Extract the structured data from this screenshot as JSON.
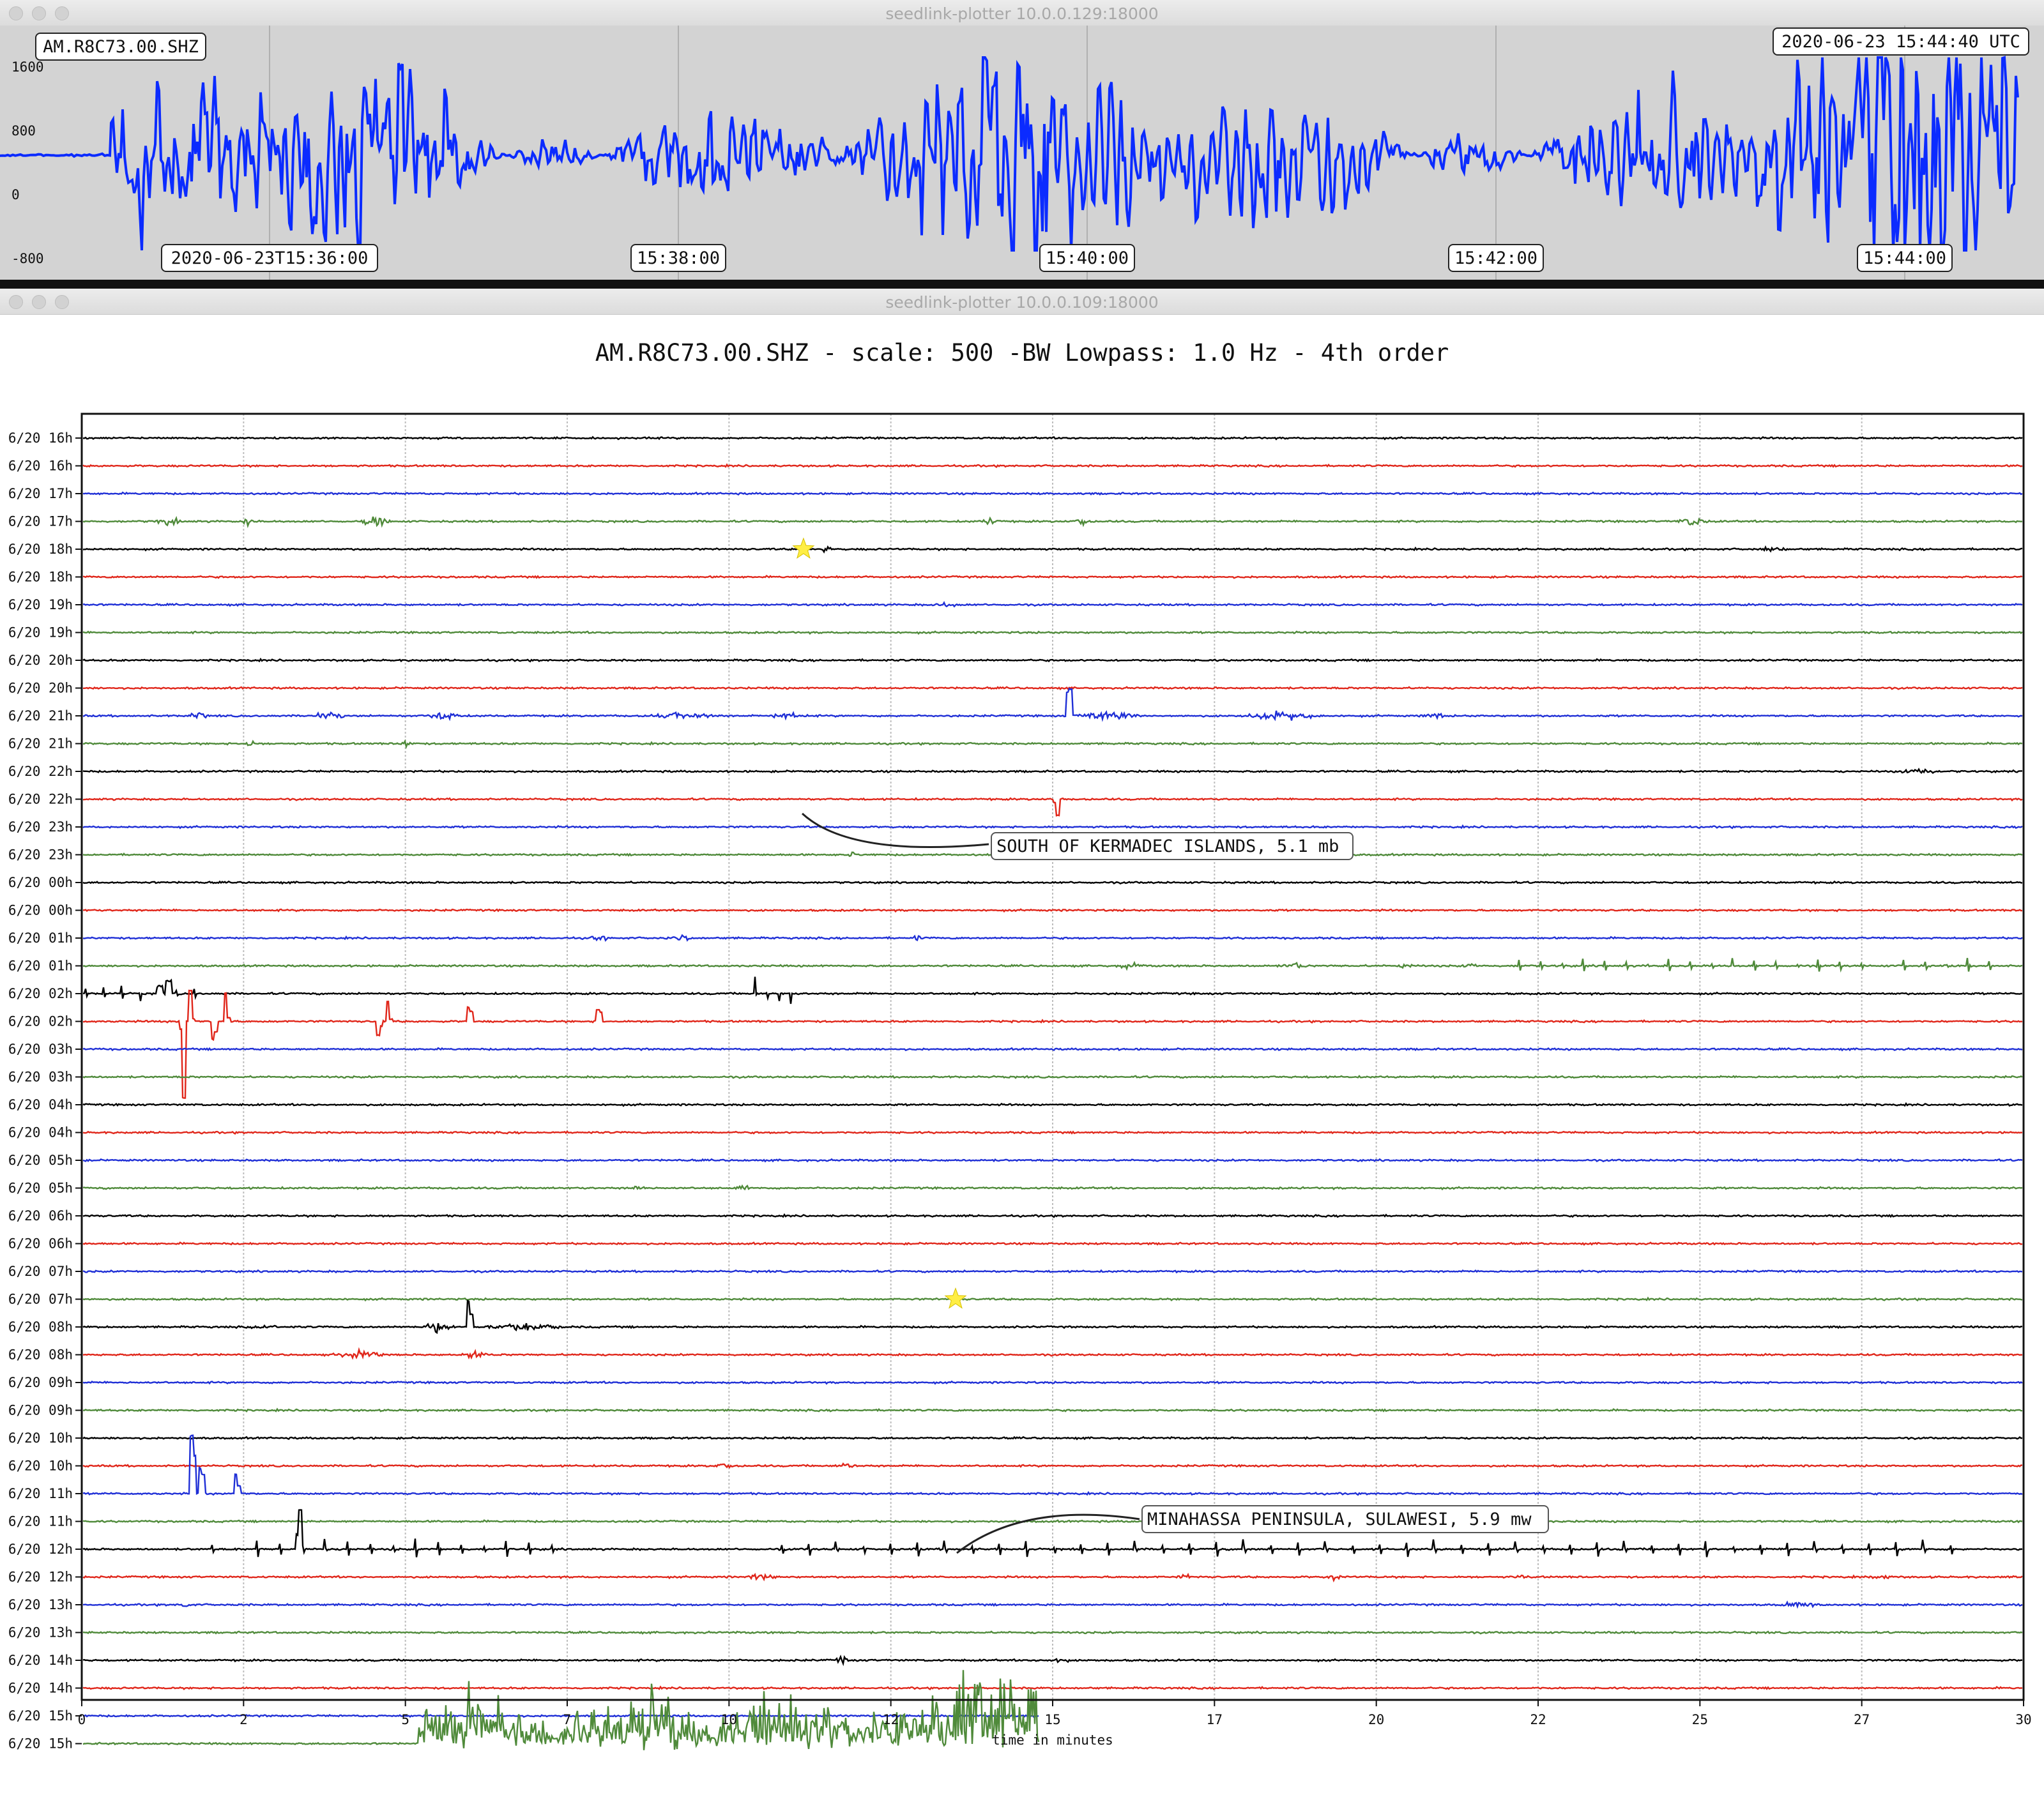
{
  "window_top": {
    "title": "seedlink-plotter 10.0.0.129:18000",
    "station_label": "AM.R8C73.00.SHZ",
    "time_label": "2020-06-23 15:44:40 UTC",
    "y_ticks": [
      "1600",
      "800",
      "0",
      "-800"
    ],
    "x_ticks": [
      "2020-06-23T15:36:00",
      "15:38:00",
      "15:40:00",
      "15:42:00",
      "15:44:00"
    ],
    "trace_color": "#0b2bff",
    "panel_color": "#d3d3d3"
  },
  "window_bottom": {
    "title": "seedlink-plotter 10.0.0.109:18000",
    "plot_title": "AM.R8C73.00.SHZ - scale: 500 -BW Lowpass: 1.0 Hz - 4th order",
    "xlabel": "time in minutes",
    "x_ticks": [
      "0",
      "2",
      "5",
      "7",
      "10",
      "12",
      "15",
      "17",
      "20",
      "22",
      "25",
      "27",
      "30"
    ],
    "colors": [
      "#000000",
      "#e0261a",
      "#1f2fd6",
      "#4f8a3a"
    ],
    "events": [
      {
        "label": "SOUTH OF KERMADEC ISLANDS, 5.1 mb"
      },
      {
        "label": "MINAHASSA PENINSULA, SULAWESI, 5.9 mw"
      }
    ]
  },
  "chart_data": {
    "type": "line",
    "title": "AM.R8C73.00.SHZ - scale: 500 -BW Lowpass: 1.0 Hz - 4th order",
    "xlabel": "time in minutes",
    "xlim": [
      0,
      30
    ],
    "row_labels": [
      "6/20 16h",
      "6/20 16h",
      "6/20 17h",
      "6/20 17h",
      "6/20 18h",
      "6/20 18h",
      "6/20 19h",
      "6/20 19h",
      "6/20 20h",
      "6/20 20h",
      "6/20 21h",
      "6/20 21h",
      "6/20 22h",
      "6/20 22h",
      "6/20 23h",
      "6/20 23h",
      "6/20 00h",
      "6/20 00h",
      "6/20 01h",
      "6/20 01h",
      "6/20 02h",
      "6/20 02h",
      "6/20 03h",
      "6/20 03h",
      "6/20 04h",
      "6/20 04h",
      "6/20 05h",
      "6/20 05h",
      "6/20 06h",
      "6/20 06h",
      "6/20 07h",
      "6/20 07h",
      "6/20 08h",
      "6/20 08h",
      "6/20 09h",
      "6/20 09h",
      "6/20 10h",
      "6/20 10h",
      "6/20 11h",
      "6/20 11h",
      "6/20 12h",
      "6/20 12h",
      "6/20 13h",
      "6/20 13h",
      "6/20 14h",
      "6/20 14h",
      "6/20 15h",
      "6/20 15h"
    ],
    "event_markers": [
      {
        "row": 4,
        "minute": 11.15,
        "label": "SOUTH OF KERMADEC ISLANDS, 5.1 mb"
      },
      {
        "row": 31,
        "minute": 13.5,
        "label": "MINAHASSA PENINSULA, SULAWESI, 5.9 mw"
      }
    ]
  }
}
